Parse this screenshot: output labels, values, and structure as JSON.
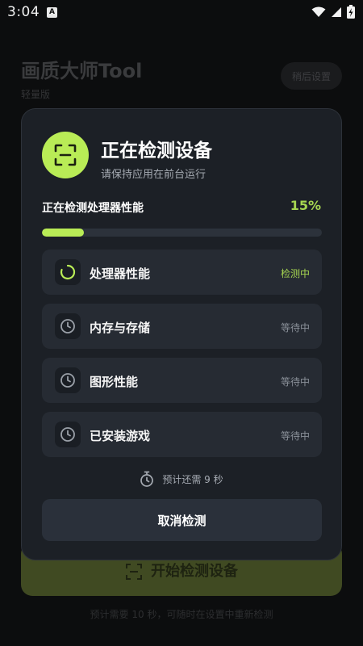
{
  "status_bar": {
    "time": "3:04",
    "notification_icon": "a-icon",
    "badge_letter": "A"
  },
  "background_app": {
    "title": "画质大师Tool",
    "subtitle": "轻量版",
    "later_button": "稍后设置",
    "start_button": "开始检测设备",
    "note": "预计需要 10 秒，可随时在设置中重新检测"
  },
  "dialog": {
    "title": "正在检测设备",
    "subtitle": "请保持应用在前台运行",
    "current_step": "正在检测处理器性能",
    "progress_text": "15%",
    "progress_value": 0.15,
    "tasks": [
      {
        "label": "处理器性能",
        "status": "检测中",
        "icon": "loading-spinner-icon",
        "active": true
      },
      {
        "label": "内存与存储",
        "status": "等待中",
        "icon": "clock-icon",
        "active": false
      },
      {
        "label": "图形性能",
        "status": "等待中",
        "icon": "clock-icon",
        "active": false
      },
      {
        "label": "已安装游戏",
        "status": "等待中",
        "icon": "clock-icon",
        "active": false
      }
    ],
    "eta": "预计还需 9 秒",
    "cancel_button": "取消检测"
  },
  "colors": {
    "accent": "#b9ec56",
    "accent_text": "#a6d651",
    "dialog_bg": "#1c2026",
    "card_bg": "#262b33"
  }
}
